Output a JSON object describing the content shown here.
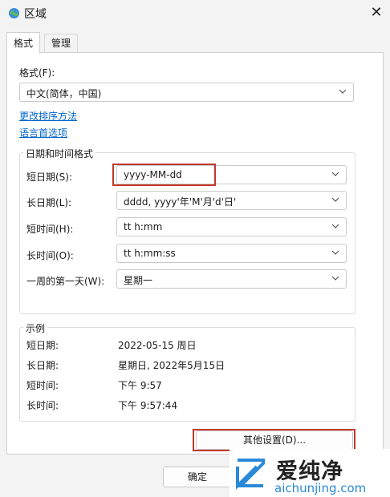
{
  "window": {
    "title": "区域"
  },
  "tabs": [
    {
      "label": "格式",
      "active": true
    },
    {
      "label": "管理",
      "active": false
    }
  ],
  "format": {
    "label": "格式(F):",
    "value": "中文(简体，中国)",
    "link_sort": "更改排序方法",
    "link_lang": "语言首选项"
  },
  "datetime": {
    "group_title": "日期和时间格式",
    "rows": [
      {
        "label": "短日期(S):",
        "value": "yyyy-MM-dd"
      },
      {
        "label": "长日期(L):",
        "value": "dddd, yyyy'年'M'月'd'日'"
      },
      {
        "label": "短时间(H):",
        "value": "tt h:mm"
      },
      {
        "label": "长时间(O):",
        "value": "tt h:mm:ss"
      },
      {
        "label": "一周的第一天(W):",
        "value": "星期一"
      }
    ]
  },
  "examples": {
    "group_title": "示例",
    "rows": [
      {
        "label": "短日期:",
        "value": "2022-05-15 周日"
      },
      {
        "label": "长日期:",
        "value": "星期日, 2022年5月15日"
      },
      {
        "label": "短时间:",
        "value": "下午 9:57"
      },
      {
        "label": "长时间:",
        "value": "下午 9:57:44"
      }
    ]
  },
  "buttons": {
    "other_settings": "其他设置(D)...",
    "ok": "确定"
  },
  "watermark": {
    "brand": "爱纯净",
    "url": "aichunjing.com"
  },
  "colors": {
    "highlight": "#c0392b",
    "link": "#0066cc"
  }
}
